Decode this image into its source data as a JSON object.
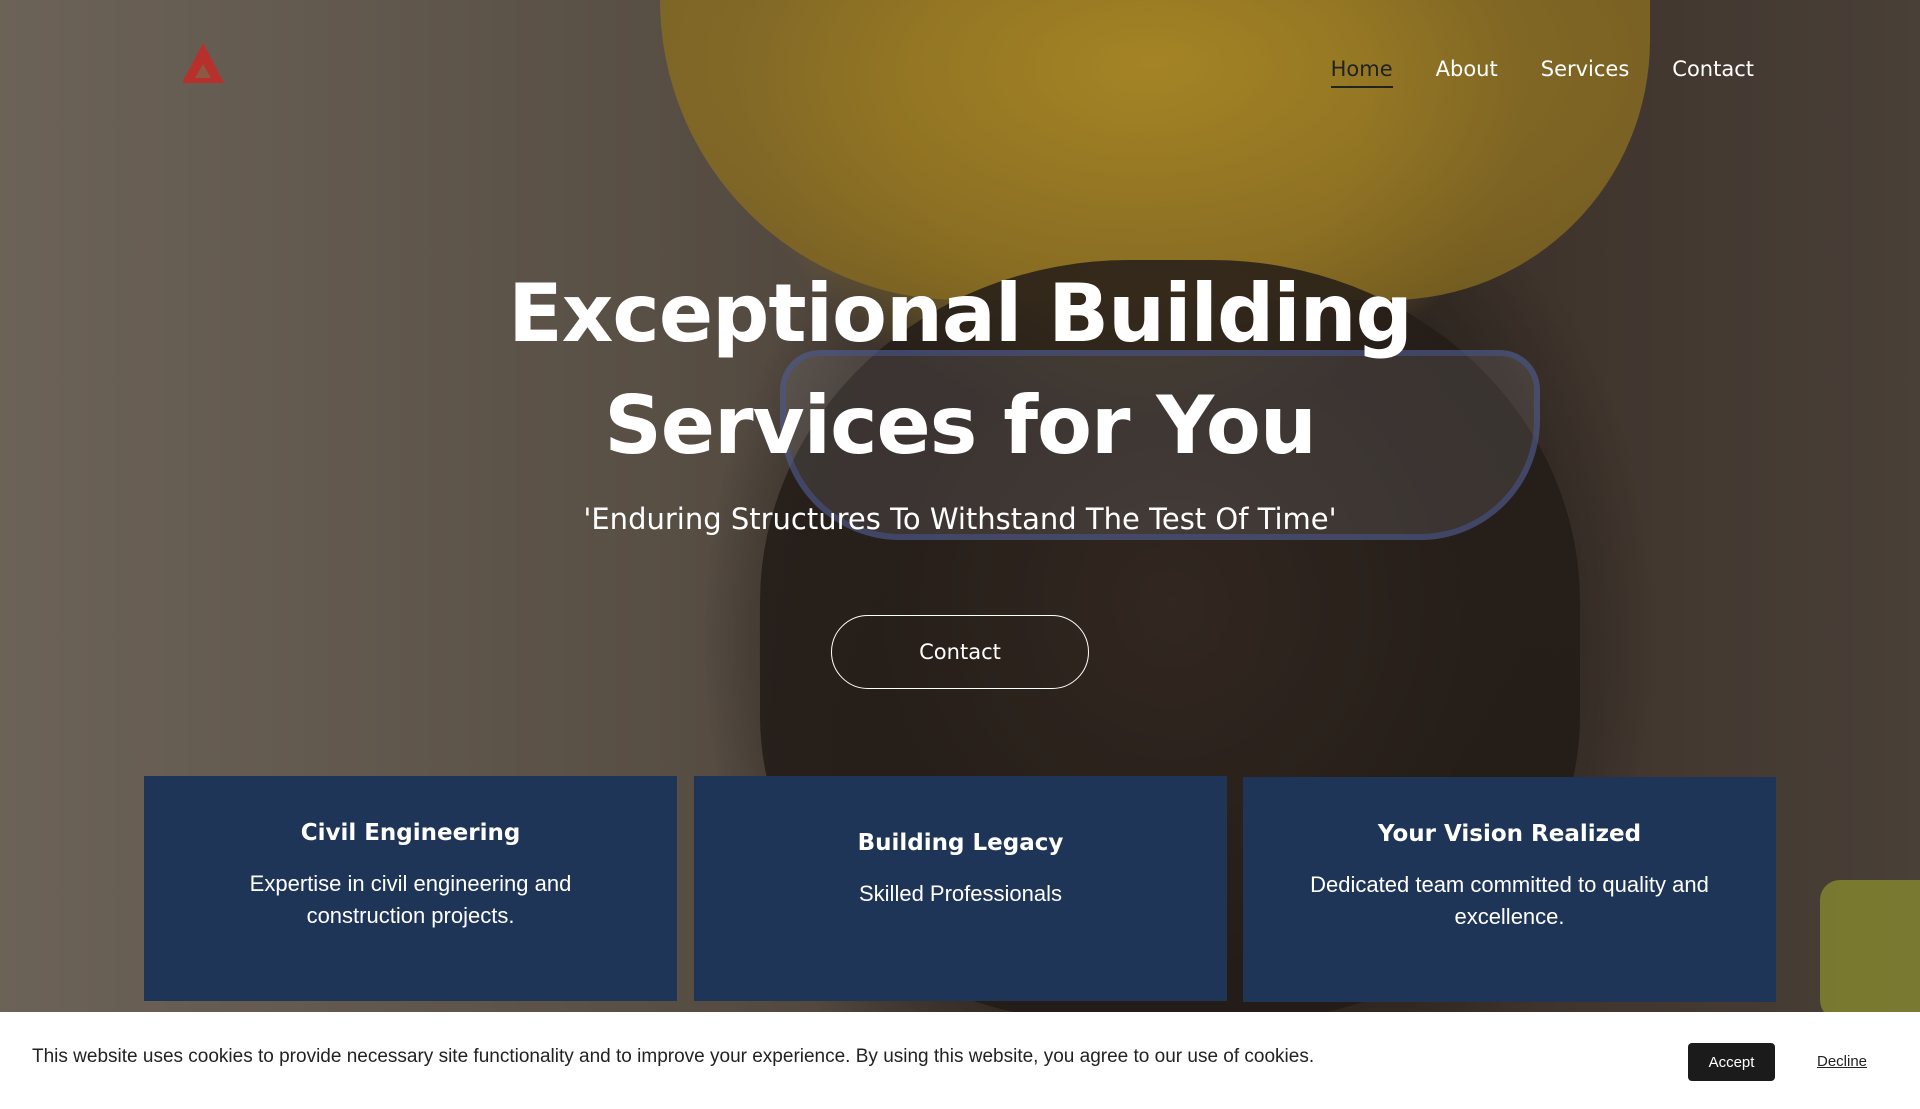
{
  "nav": {
    "items": [
      {
        "label": "Home",
        "active": true
      },
      {
        "label": "About",
        "active": false
      },
      {
        "label": "Services",
        "active": false
      },
      {
        "label": "Contact",
        "active": false
      }
    ]
  },
  "brand": {
    "logo_icon": "triangle-logo",
    "logo_color": "#b8302b"
  },
  "hero": {
    "headline_line1": "Exceptional Building",
    "headline_line2": "Services for You",
    "tagline": "'Enduring Structures To Withstand The Test Of Time'",
    "button_label": "Contact"
  },
  "cards": [
    {
      "title": "Civil Engineering",
      "text": "Expertise in civil engineering and construction projects."
    },
    {
      "title": "Building Legacy",
      "text": "Skilled Professionals"
    },
    {
      "title": "Your Vision Realized",
      "text": "Dedicated team committed to quality and excellence."
    }
  ],
  "cookie": {
    "message": "This website uses cookies to provide necessary site functionality and to improve your experience. By using this website, you agree to our use of cookies.",
    "accept_label": "Accept",
    "decline_label": "Decline"
  },
  "colors": {
    "card_bg": "#1f3558",
    "accent": "#b8302b"
  }
}
